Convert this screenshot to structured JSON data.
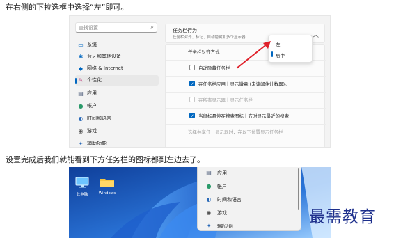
{
  "article": {
    "para1": "在右侧的下拉选框中选择“左”即可。",
    "para2": "设置完成后我们就能看到下方任务栏的图标都到左边去了。"
  },
  "settings": {
    "search_placeholder": "查找设置",
    "search_icon": "search-icon",
    "nav": [
      {
        "label": "系统",
        "icon": "monitor-icon",
        "active": false
      },
      {
        "label": "蓝牙和其他设备",
        "icon": "bluetooth-icon",
        "active": false
      },
      {
        "label": "网络 & Internet",
        "icon": "wifi-icon",
        "active": false
      },
      {
        "label": "个性化",
        "icon": "brush-icon",
        "active": true
      },
      {
        "label": "应用",
        "icon": "apps-icon",
        "active": false
      },
      {
        "label": "帐户",
        "icon": "person-icon",
        "active": false
      },
      {
        "label": "时间和语言",
        "icon": "clock-globe-icon",
        "active": false
      },
      {
        "label": "游戏",
        "icon": "gamepad-icon",
        "active": false
      },
      {
        "label": "辅助功能",
        "icon": "accessibility-icon",
        "active": false
      }
    ],
    "section": {
      "title": "任务栏行为",
      "subtitle": "任务栏对齐、标记、自动隐藏和多个显示器"
    },
    "rows": [
      {
        "label": "任务栏对齐方式",
        "checkbox": false,
        "checked": false,
        "dim": false
      },
      {
        "label": "自动隐藏任务栏",
        "checkbox": true,
        "checked": false,
        "dim": false
      },
      {
        "label": "在任务栏应用上显示徽章 (未读邮件计数器)。",
        "checkbox": true,
        "checked": true,
        "dim": false
      },
      {
        "label": "在所有显示器上显示任务栏",
        "checkbox": true,
        "checked": false,
        "dim": true
      },
      {
        "label": "当鼠标悬停在搜索图标上方时显示最近的搜索",
        "checkbox": true,
        "checked": true,
        "dim": false
      },
      {
        "label": "选择共享任一显示器时，在以下位置显示任务栏",
        "checkbox": false,
        "checked": false,
        "dim": true
      }
    ],
    "dropdown": {
      "options": [
        "左",
        "居中"
      ],
      "selected": "居中"
    },
    "accent": "#0067c0",
    "arrow_color": "#e0202a"
  },
  "desktop": {
    "icons": [
      {
        "label": "此电脑",
        "icon": "computer-icon"
      },
      {
        "label": "Windows",
        "icon": "folder-icon"
      }
    ],
    "start_menu": [
      {
        "label": "应用",
        "icon": "apps-icon"
      },
      {
        "label": "帐户",
        "icon": "person-icon"
      },
      {
        "label": "时间和语言",
        "icon": "clock-globe-icon"
      },
      {
        "label": "游戏",
        "icon": "gamepad-icon"
      },
      {
        "label": "辅助功能",
        "icon": "accessibility-icon"
      }
    ]
  },
  "watermark": "最需教育"
}
